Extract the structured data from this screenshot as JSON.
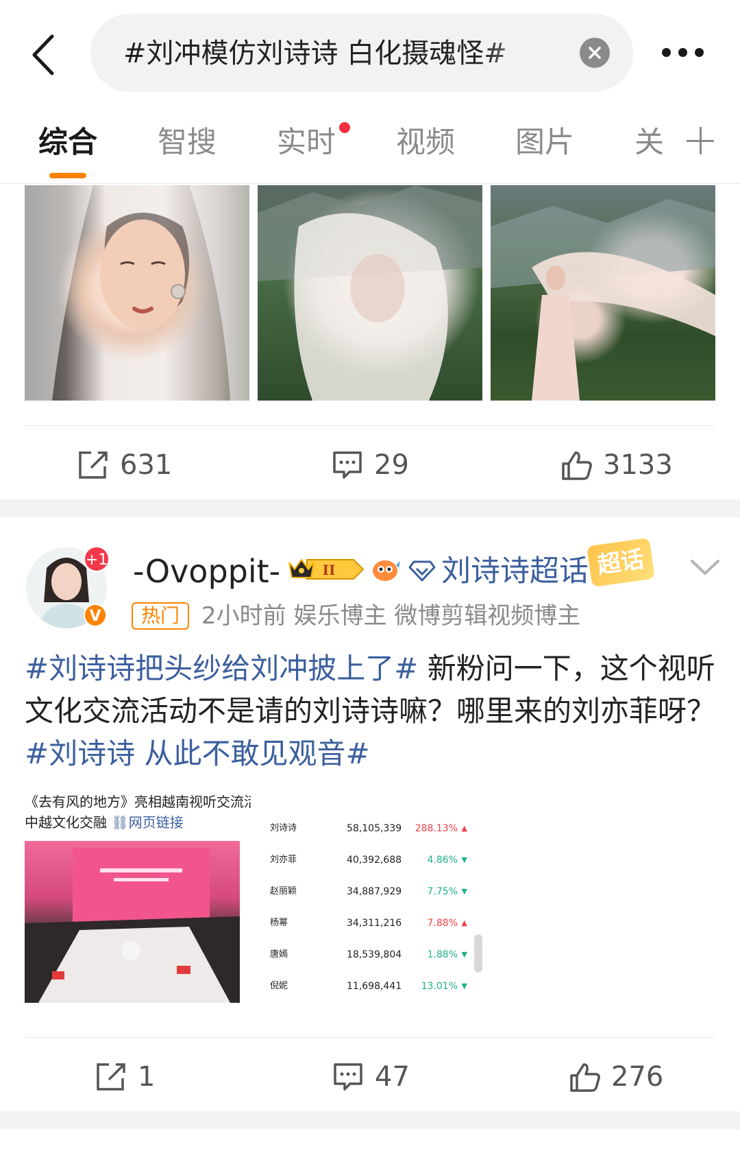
{
  "header": {
    "search_text": "#刘冲模仿刘诗诗 白化摄魂怪#"
  },
  "tabs": [
    {
      "label": "综合",
      "active": true
    },
    {
      "label": "智搜"
    },
    {
      "label": "实时",
      "has_dot": true
    },
    {
      "label": "视频"
    },
    {
      "label": "图片"
    },
    {
      "label": "关"
    }
  ],
  "post1": {
    "actions": {
      "repost": "631",
      "comment": "29",
      "like": "3133"
    }
  },
  "post2": {
    "avatar_badge": "+1",
    "verified_badge": "V",
    "username": "-Ovoppit-",
    "level_badge": "II",
    "supertopic": "刘诗诗超话",
    "supertopic_badge": "超话",
    "hot_tag": "热门",
    "meta": "2小时前  娱乐博主 微博剪辑视频博主",
    "text": {
      "tag1": "#刘诗诗把头纱给刘冲披上了#",
      "body": " 新粉问一下，这个视听文化交流活动不是请的刘诗诗嘛？哪里来的刘亦菲呀？",
      "tag2": "#刘诗诗 从此不敢见观音#"
    },
    "link_card": {
      "title": "《去有风的地方》亮相越南视听交流活",
      "line2": "中越文化交融",
      "link": "网页链接"
    },
    "rank_table": {
      "rows": [
        {
          "name": "刘诗诗",
          "value": "58,105,339",
          "pct": "288.13%",
          "dir": "up"
        },
        {
          "name": "刘亦菲",
          "value": "40,392,688",
          "pct": "4.86%",
          "dir": "down"
        },
        {
          "name": "赵丽颖",
          "value": "34,887,929",
          "pct": "7.75%",
          "dir": "down"
        },
        {
          "name": "杨幂",
          "value": "34,311,216",
          "pct": "7.88%",
          "dir": "up"
        },
        {
          "name": "唐嫣",
          "value": "18,539,804",
          "pct": "1.88%",
          "dir": "down"
        },
        {
          "name": "倪妮",
          "value": "11,698,441",
          "pct": "13.01%",
          "dir": "down"
        }
      ]
    },
    "actions": {
      "repost": "1",
      "comment": "47",
      "like": "276"
    }
  },
  "colors": {
    "accent": "#ff8200",
    "link": "#3b5f9e",
    "notification": "#f52f3e",
    "up": "#f0404a",
    "down": "#20b28a"
  }
}
